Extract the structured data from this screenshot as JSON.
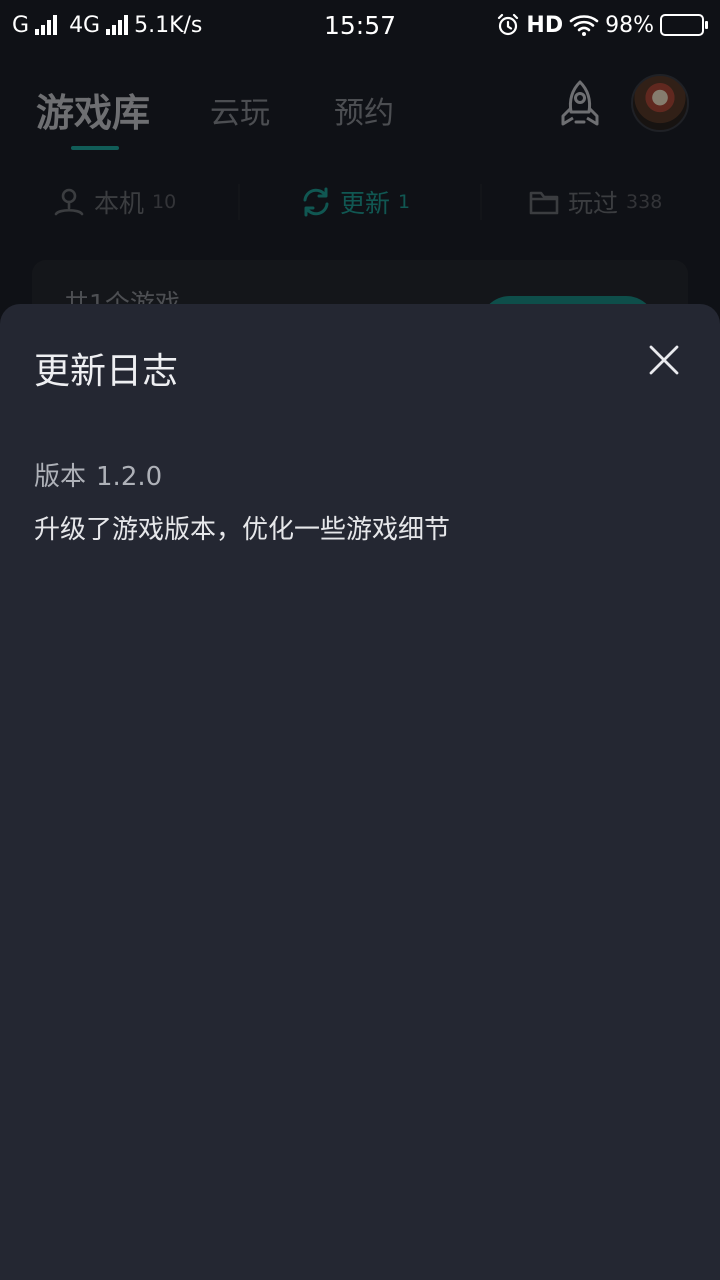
{
  "status_bar": {
    "carrier_1": "G",
    "carrier_2": "4G",
    "speed": "5.1K/s",
    "time": "15:57",
    "hd": "HD",
    "battery": "98%",
    "battery_level": 0.98
  },
  "header": {
    "tabs": [
      {
        "label": "游戏库",
        "active": true
      },
      {
        "label": "云玩"
      },
      {
        "label": "预约"
      }
    ],
    "accent_color": "#1fa9a0",
    "icons": [
      "rocket-icon",
      "avatar"
    ]
  },
  "subtabs": [
    {
      "label": "本机",
      "count": "10",
      "icon": "local-device-icon"
    },
    {
      "label": "更新",
      "count": "1",
      "icon": "refresh-icon",
      "active": true
    },
    {
      "label": "玩过",
      "count": "338",
      "icon": "folder-icon"
    }
  ],
  "card": {
    "text": "共1个游戏"
  },
  "sheet": {
    "title": "更新日志",
    "version_label": "版本",
    "version": "1.2.0",
    "notes": "升级了游戏版本，优化一些游戏细节",
    "close_icon": "close-icon"
  },
  "colors": {
    "background": "#1d2028",
    "sheet": "#242732",
    "accent": "#1fa9a0"
  }
}
